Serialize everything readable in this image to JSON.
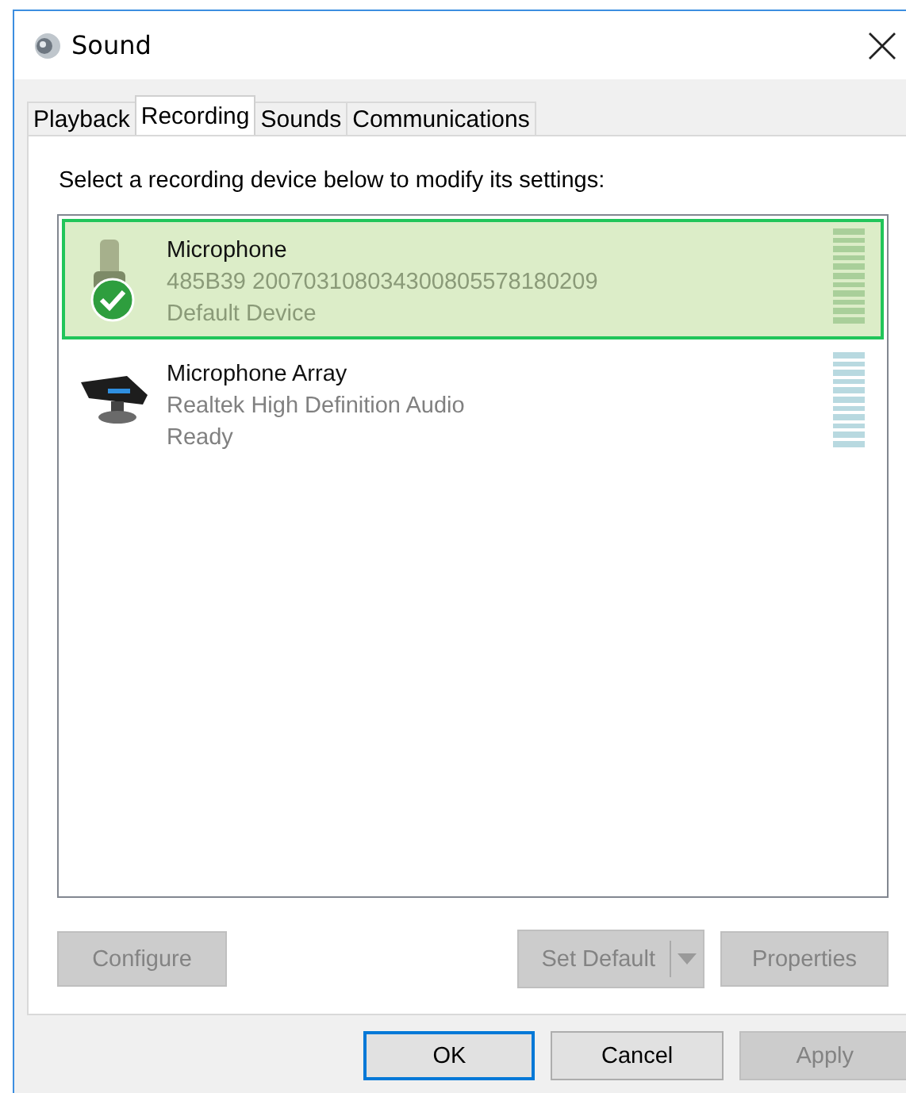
{
  "window": {
    "title": "Sound"
  },
  "tabs": [
    {
      "label": "Playback",
      "selected": false
    },
    {
      "label": "Recording",
      "selected": true
    },
    {
      "label": "Sounds",
      "selected": false
    },
    {
      "label": "Communications",
      "selected": false
    }
  ],
  "instruction": "Select a recording device below to modify its settings:",
  "devices": [
    {
      "kind": "microphone",
      "name": "Microphone",
      "description": "485B39 200703108034300805578180209",
      "status": "Default Device",
      "selected": true,
      "default": true
    },
    {
      "kind": "array",
      "name": "Microphone Array",
      "description": "Realtek High Definition Audio",
      "status": "Ready",
      "selected": false,
      "default": false
    }
  ],
  "device_buttons": [
    {
      "kind": "plain",
      "label": "Configure",
      "disabled": true
    },
    {
      "kind": "split",
      "label": "Set Default",
      "disabled": true
    },
    {
      "kind": "plain",
      "label": "Properties",
      "disabled": true
    }
  ],
  "dialog_buttons": [
    {
      "label": "OK",
      "focused": true,
      "disabled": false
    },
    {
      "label": "Cancel",
      "focused": false,
      "disabled": false
    },
    {
      "label": "Apply",
      "focused": false,
      "disabled": true
    }
  ]
}
